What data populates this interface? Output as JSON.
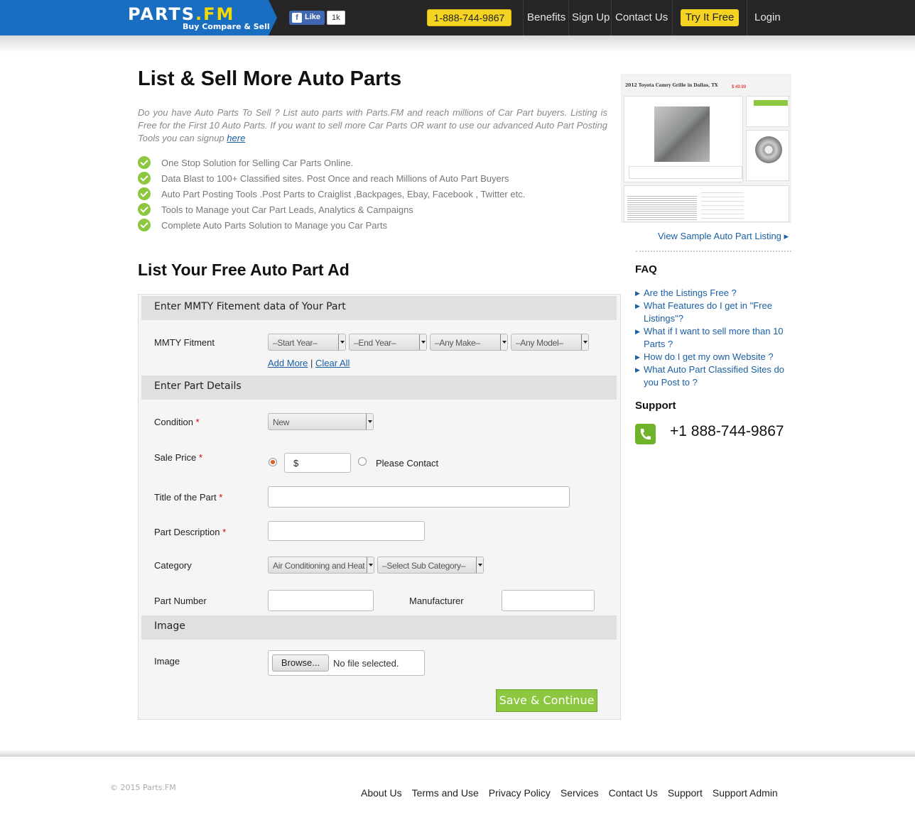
{
  "header": {
    "logo_main": "PARTS",
    "logo_fm": ".FM",
    "logo_tagline": "Buy Compare & Sell",
    "fb_like_label": "Like",
    "fb_like_count": "1k",
    "phone_button": "1-888-744-9867",
    "nav": [
      "Benefits",
      "Sign Up",
      "Contact Us"
    ],
    "try_button": "Try It Free",
    "login": "Login",
    "brand_blue": "#1a6ec2",
    "accent_yellow": "#f5d323"
  },
  "main": {
    "title": "List & Sell More Auto Parts",
    "intro_text": "Do you have Auto Parts To Sell ? List auto parts with Parts.FM and reach millions of Car Part buyers. Listing is Free for the First 10 Auto Parts. If you want to sell more Car Parts OR want to use our advanced Auto Part Posting Tools you can signup ",
    "intro_link": "here",
    "features": [
      "One Stop Solution for Selling Car Parts Online.",
      "Data Blast to 100+ Classified sites. Post Once and reach Millions of Auto Part Buyers",
      "Auto Part Posting Tools .Post Parts to Craiglist ,Backpages, Ebay, Facebook , Twitter etc.",
      "Tools to Manage yout Car Part Leads, Analytics & Campaigns",
      "Complete Auto Parts Solution to Manage you Car Parts"
    ],
    "form_title": "List Your Free Auto Part Ad"
  },
  "form": {
    "section_mmty": "Enter MMTY Fitement data of Your Part",
    "mmty_label": "MMTY Fitment",
    "mmty_selects": [
      "–Start Year–",
      "–End Year–",
      "–Any Make–",
      "–Any Model–"
    ],
    "add_more": "Add More",
    "link_sep": "|",
    "clear_all": "Clear All",
    "section_details": "Enter Part Details",
    "condition_label": "Condition",
    "condition_value": "New",
    "sale_price_label": "Sale Price",
    "price_prefix": "$",
    "please_contact": "Please Contact",
    "title_label": "Title of the Part",
    "description_label": "Part Description",
    "category_label": "Category",
    "category_value": "Air Conditioning and Heat",
    "subcategory_value": "–Select Sub Category–",
    "part_number_label": "Part Number",
    "manufacturer_label": "Manufacturer",
    "section_image": "Image",
    "image_label": "Image",
    "browse_button": "Browse...",
    "no_file": "No file selected.",
    "required_mark": "*",
    "save_button": "Save & Continue",
    "save_color": "#8dc63f"
  },
  "sidebar": {
    "sample_heading": "2012 Toyota Camry Grille in Dallas, TX",
    "sample_price": "$ 49.99",
    "sample_link": "View Sample Auto Part Listing ▸",
    "faq_title": "FAQ",
    "faq": [
      "Are the Listings Free ?",
      "What Features do I get in \"Free Listings\"?",
      "What if I want to sell more than 10 Parts ?",
      "How do I get my own Website ?",
      "What Auto Part Classified Sites do you Post to ?"
    ],
    "support_title": "Support",
    "support_phone": "+1 888-744-9867"
  },
  "footer": {
    "copyright": "© 2015 Parts.FM",
    "links": [
      "About Us",
      "Terms and Use",
      "Privacy Policy",
      "Services",
      "Contact Us",
      "Support",
      "Support Admin"
    ]
  }
}
